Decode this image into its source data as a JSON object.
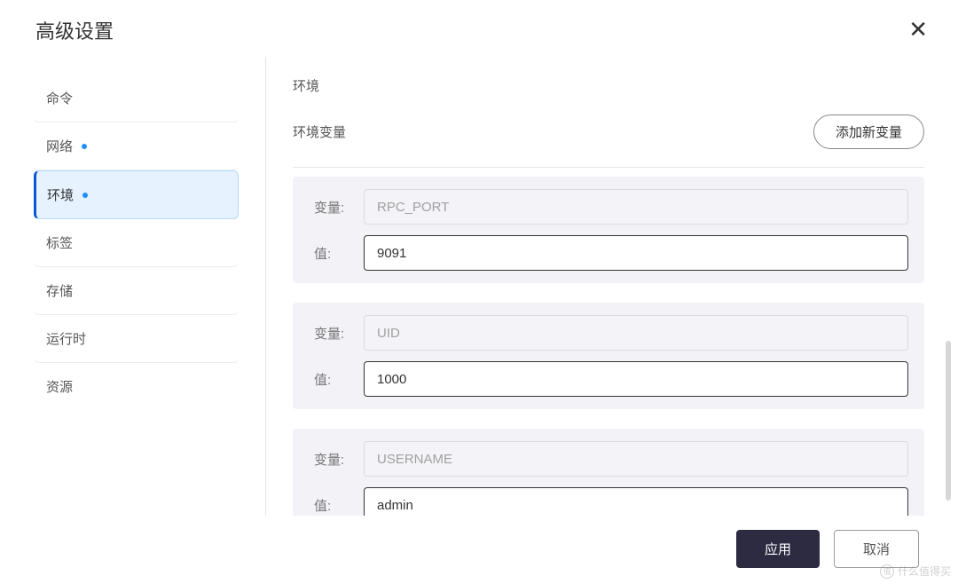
{
  "dialog": {
    "title": "高级设置",
    "close_symbol": "✕"
  },
  "sidebar": {
    "items": [
      {
        "label": "命令",
        "active": false,
        "has_dot": false
      },
      {
        "label": "网络",
        "active": false,
        "has_dot": true
      },
      {
        "label": "环境",
        "active": true,
        "has_dot": true
      },
      {
        "label": "标签",
        "active": false,
        "has_dot": false
      },
      {
        "label": "存储",
        "active": false,
        "has_dot": false
      },
      {
        "label": "运行时",
        "active": false,
        "has_dot": false
      },
      {
        "label": "资源",
        "active": false,
        "has_dot": false
      }
    ]
  },
  "content": {
    "section_title": "环境",
    "sub_label": "环境变量",
    "add_button": "添加新变量",
    "var_key_label": "变量:",
    "var_value_label": "值:",
    "vars": [
      {
        "key": "RPC_PORT",
        "value": "9091"
      },
      {
        "key": "UID",
        "value": "1000"
      },
      {
        "key": "USERNAME",
        "value": "admin"
      }
    ]
  },
  "footer": {
    "apply": "应用",
    "cancel": "取消"
  },
  "watermark": "什么值得买"
}
